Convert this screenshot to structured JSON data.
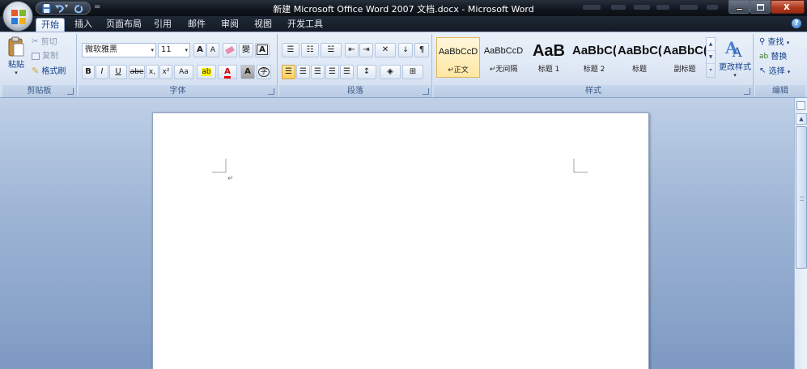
{
  "window": {
    "title": "新建 Microsoft Office Word 2007 文档.docx - Microsoft Word"
  },
  "tabs": [
    {
      "label": "开始",
      "active": true
    },
    {
      "label": "插入"
    },
    {
      "label": "页面布局"
    },
    {
      "label": "引用"
    },
    {
      "label": "邮件"
    },
    {
      "label": "审阅"
    },
    {
      "label": "视图"
    },
    {
      "label": "开发工具"
    }
  ],
  "clipboard": {
    "paste_label": "粘贴",
    "cut_label": "剪切",
    "copy_label": "复制",
    "format_painter_label": "格式刷",
    "caption": "剪贴板"
  },
  "font": {
    "font_name": "微软雅黑",
    "font_size": "11",
    "grow_label": "A",
    "shrink_label": "A",
    "clear_label": "",
    "phonetic_label": "變",
    "border_label": "A",
    "bold_label": "B",
    "italic_label": "I",
    "underline_label": "U",
    "strike_label": "abe",
    "sub_label": "x,",
    "sup_label": "x²",
    "case_label": "Aa",
    "highlight_label": "ab",
    "color_label": "A",
    "shade_label": "A",
    "enclose_label": "字",
    "caption": "字体"
  },
  "paragraph": {
    "caption": "段落"
  },
  "styles": {
    "items": [
      {
        "sample": "AaBbCcD",
        "name": "↵正文",
        "selected": true
      },
      {
        "sample": "AaBbCcD",
        "name": "↵无间隔"
      },
      {
        "sample": "AaB",
        "name": "标题 1"
      },
      {
        "sample": "AaBbC(",
        "name": "标题 2"
      },
      {
        "sample": "AaBbC(",
        "name": "标题"
      },
      {
        "sample": "AaBbC(",
        "name": "副标题"
      }
    ],
    "change_styles_label": "更改样式",
    "caption": "样式"
  },
  "editing": {
    "find_label": "查找",
    "replace_label": "替换",
    "select_label": "选择",
    "caption": "编辑"
  },
  "document": {
    "paragraph_mark": "↵"
  },
  "colors": {
    "accent": "#15428b",
    "ribbon": "#dfe8f5",
    "titlebar": "#10151d",
    "selected_style": "#ffe7a2"
  }
}
